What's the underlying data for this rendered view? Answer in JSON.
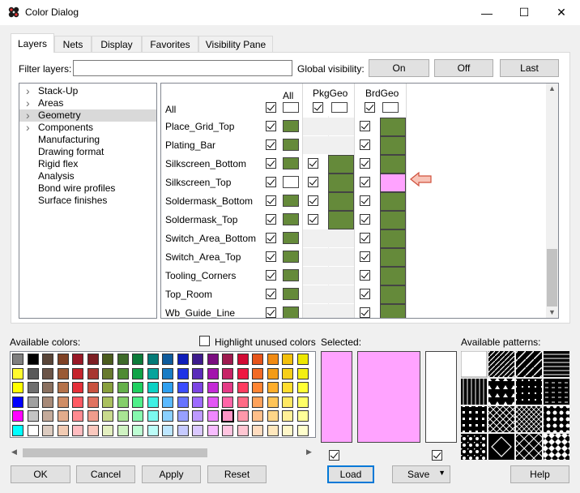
{
  "window": {
    "title": "Color Dialog",
    "minimize": "—",
    "maximize": "☐",
    "close": "✕"
  },
  "tabs": [
    {
      "label": "Layers",
      "active": true
    },
    {
      "label": "Nets"
    },
    {
      "label": "Display"
    },
    {
      "label": "Favorites"
    },
    {
      "label": "Visibility Pane"
    }
  ],
  "filter": {
    "label": "Filter layers:",
    "value": "",
    "placeholder": ""
  },
  "global_visibility": {
    "label": "Global visibility:",
    "on": "On",
    "off": "Off",
    "last": "Last"
  },
  "tree": [
    {
      "label": "Stack-Up",
      "expandable": true
    },
    {
      "label": "Areas",
      "expandable": true
    },
    {
      "label": "Geometry",
      "expandable": true,
      "selected": true
    },
    {
      "label": "Components",
      "expandable": true
    },
    {
      "label": "Manufacturing",
      "expandable": false
    },
    {
      "label": "Drawing format",
      "expandable": false
    },
    {
      "label": "Rigid flex",
      "expandable": false
    },
    {
      "label": "Analysis",
      "expandable": false
    },
    {
      "label": "Bond wire profiles",
      "expandable": false
    },
    {
      "label": "Surface finishes",
      "expandable": false
    }
  ],
  "grid": {
    "columns": {
      "all": "All",
      "pkggeo": "PkgGeo",
      "brdgeo": "BrdGeo"
    },
    "all_row": {
      "label": "All"
    },
    "rows": [
      {
        "name": "Place_Grid_Top",
        "all": true,
        "pkg": null,
        "brd": true
      },
      {
        "name": "Plating_Bar",
        "all": true,
        "pkg": null,
        "brd": true
      },
      {
        "name": "Silkscreen_Bottom",
        "all": true,
        "pkg": true,
        "brd": true
      },
      {
        "name": "Silkscreen_Top",
        "all": true,
        "pkg": true,
        "brd": true,
        "highlight": true
      },
      {
        "name": "Soldermask_Bottom",
        "all": true,
        "pkg": true,
        "brd": true
      },
      {
        "name": "Soldermask_Top",
        "all": true,
        "pkg": true,
        "brd": true
      },
      {
        "name": "Switch_Area_Bottom",
        "all": true,
        "pkg": null,
        "brd": true
      },
      {
        "name": "Switch_Area_Top",
        "all": true,
        "pkg": null,
        "brd": true
      },
      {
        "name": "Tooling_Corners",
        "all": true,
        "pkg": null,
        "brd": true
      },
      {
        "name": "Top_Room",
        "all": true,
        "pkg": null,
        "brd": true
      },
      {
        "name": "Wb_Guide_Line",
        "all": true,
        "pkg": null,
        "brd": true
      }
    ],
    "green": "#658a3a",
    "pink": "#ffa3ff"
  },
  "available_colors": {
    "label": "Available colors:",
    "highlight_unused": "Highlight unused colors",
    "rows": [
      [
        "#7f7f7f",
        "#000000",
        "#584438",
        "#7f4125",
        "#991827",
        "#7c1e23",
        "#4b5c1e",
        "#3d6a2a",
        "#0c7b3a",
        "#047a77",
        "#0e5b9c",
        "#0e1dba",
        "#3d1b8d",
        "#7a0d80",
        "#9e1a4f",
        "#d10b35",
        "#e6541a",
        "#f08a12",
        "#f2c00c",
        "#ede700"
      ],
      [
        "#fffb2e",
        "#595959",
        "#6b5447",
        "#9a5a36",
        "#c5242c",
        "#a83731",
        "#687a2d",
        "#4f8b33",
        "#0fa347",
        "#06a49c",
        "#187cc5",
        "#1f33e6",
        "#5a2cba",
        "#a313ad",
        "#c72366",
        "#ef1842",
        "#f26a24",
        "#f49c16",
        "#f7cf17",
        "#f4ef12"
      ],
      [
        "#ffff00",
        "#6f6f6f",
        "#8a7060",
        "#b5724a",
        "#e5303a",
        "#c9523f",
        "#89a03d",
        "#64b04a",
        "#1fd060",
        "#0bd1c4",
        "#2ea0f0",
        "#3b4cff",
        "#7c45e3",
        "#c42bd6",
        "#e53b86",
        "#ff3b5f",
        "#ff8534",
        "#ffae2a",
        "#ffdd2e",
        "#ffff33"
      ],
      [
        "#0000ff",
        "#a0a0a0",
        "#a88a78",
        "#d08d66",
        "#ff5a63",
        "#e07260",
        "#aac05e",
        "#85cf6b",
        "#4ff08a",
        "#3ff0e4",
        "#5ab9ff",
        "#6774ff",
        "#9d6bff",
        "#e356f5",
        "#ff65a7",
        "#ff6a85",
        "#ffa25a",
        "#ffc457",
        "#ffe862",
        "#ffff66"
      ],
      [
        "#ff00ff",
        "#c4c4c4",
        "#c4aa9a",
        "#e3ac8c",
        "#ff8a90",
        "#f09c8c",
        "#c9da8c",
        "#a9e594",
        "#86f9ae",
        "#7bf9f0",
        "#8ad0ff",
        "#97a0ff",
        "#bd99ff",
        "#f087ff",
        "#ff94c5",
        "#ff98aa",
        "#ffbf8a",
        "#ffd688",
        "#fff097",
        "#ffff99"
      ],
      [
        "#00ffff",
        "#ffffff",
        "#dccbc0",
        "#f2cbb3",
        "#ffbcc0",
        "#fbc8be",
        "#e3efc0",
        "#cff3c2",
        "#bdfdd3",
        "#bbfdf8",
        "#bde6ff",
        "#c6caff",
        "#dac8ff",
        "#f8bcff",
        "#ffc4e0",
        "#ffc6d2",
        "#ffdcbf",
        "#ffe8bd",
        "#fff7c8",
        "#ffffcc"
      ]
    ],
    "selected_cell": [
      4,
      14
    ]
  },
  "selected": {
    "label": "Selected:",
    "color": "#ffa3ff"
  },
  "available_patterns": {
    "label": "Available patterns:"
  },
  "buttons": {
    "ok": "OK",
    "cancel": "Cancel",
    "apply": "Apply",
    "reset": "Reset",
    "load": "Load",
    "save": "Save",
    "help": "Help"
  }
}
